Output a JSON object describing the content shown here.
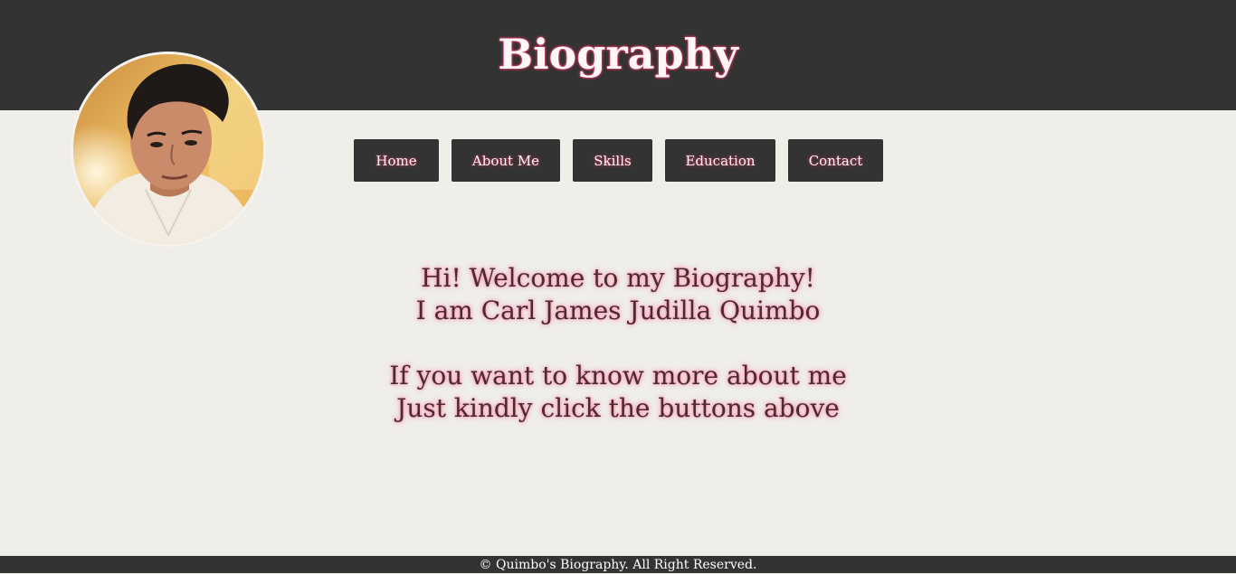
{
  "header": {
    "title": "Biography"
  },
  "avatar": {
    "alt": "Profile photo"
  },
  "nav": {
    "items": [
      {
        "label": "Home"
      },
      {
        "label": "About Me"
      },
      {
        "label": "Skills"
      },
      {
        "label": "Education"
      },
      {
        "label": "Contact"
      }
    ]
  },
  "welcome": {
    "line1": "Hi! Welcome to my Biography!",
    "line2": "I am Carl James Judilla Quimbo",
    "line3": "If you want to know more about me",
    "line4": "Just kindly click the buttons above"
  },
  "footer": {
    "text": "© Quimbo's Biography. All Right Reserved."
  },
  "colors": {
    "header_bg": "#333333",
    "page_bg": "#efeee9",
    "glow": "#ff3b6b"
  }
}
